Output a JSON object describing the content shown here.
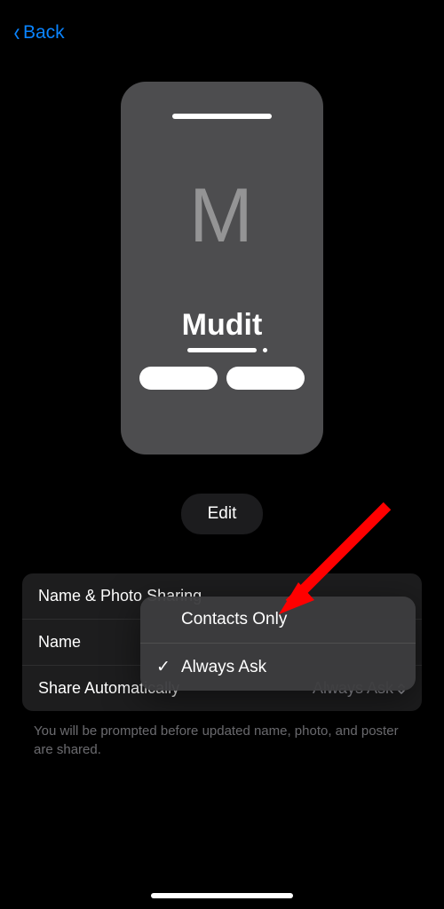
{
  "nav": {
    "back_label": "Back"
  },
  "poster": {
    "initial": "M",
    "name": "Mudit"
  },
  "edit_label": "Edit",
  "settings": {
    "rows": [
      {
        "label": "Name & Photo Sharing",
        "value": ""
      },
      {
        "label": "Name",
        "value": ""
      },
      {
        "label": "Share Automatically",
        "value": "Always Ask"
      }
    ]
  },
  "popover": {
    "options": [
      {
        "label": "Contacts Only",
        "selected": false
      },
      {
        "label": "Always Ask",
        "selected": true
      }
    ]
  },
  "footer": "You will be prompted before updated name, photo, and poster are shared.",
  "checkmark": "✓"
}
